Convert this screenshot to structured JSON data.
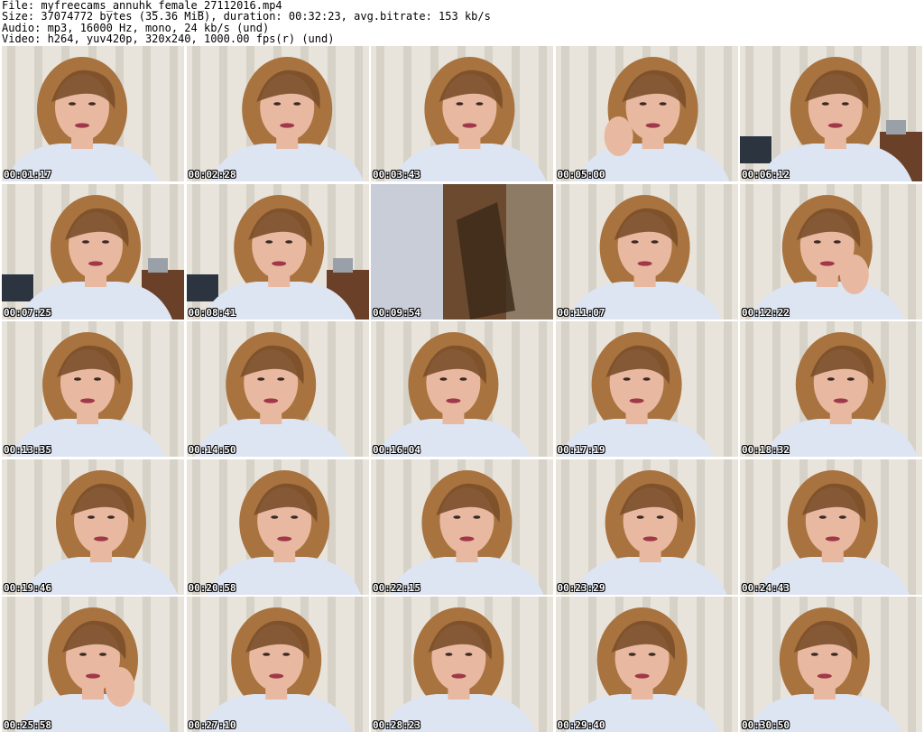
{
  "header": {
    "file": "File: myfreecams_annuhk_female_27112016.mp4",
    "size": "Size: 37074772 bytes (35.36 MiB), duration: 00:32:23, avg.bitrate: 153 kb/s",
    "audio": "Audio: mp3, 16000 Hz, mono, 24 kb/s (und)",
    "video": "Video: h264, yuv420p, 320x240, 1000.00 fps(r) (und)"
  },
  "thumbnails": [
    {
      "time": "00:01:17",
      "variant": "face"
    },
    {
      "time": "00:02:28",
      "variant": "face"
    },
    {
      "time": "00:03:43",
      "variant": "face"
    },
    {
      "time": "00:05:00",
      "variant": "pose"
    },
    {
      "time": "00:06:12",
      "variant": "room"
    },
    {
      "time": "00:07:25",
      "variant": "room"
    },
    {
      "time": "00:08:41",
      "variant": "room"
    },
    {
      "time": "00:09:54",
      "variant": "blur"
    },
    {
      "time": "00:11:07",
      "variant": "face"
    },
    {
      "time": "00:12:22",
      "variant": "hand"
    },
    {
      "time": "00:13:35",
      "variant": "face"
    },
    {
      "time": "00:14:50",
      "variant": "face"
    },
    {
      "time": "00:16:04",
      "variant": "face"
    },
    {
      "time": "00:17:19",
      "variant": "face"
    },
    {
      "time": "00:18:32",
      "variant": "face"
    },
    {
      "time": "00:19:46",
      "variant": "face"
    },
    {
      "time": "00:20:58",
      "variant": "face"
    },
    {
      "time": "00:22:15",
      "variant": "face"
    },
    {
      "time": "00:23:29",
      "variant": "face"
    },
    {
      "time": "00:24:43",
      "variant": "face"
    },
    {
      "time": "00:25:58",
      "variant": "hand"
    },
    {
      "time": "00:27:10",
      "variant": "face"
    },
    {
      "time": "00:28:23",
      "variant": "face"
    },
    {
      "time": "00:29:40",
      "variant": "face"
    },
    {
      "time": "00:30:50",
      "variant": "face"
    }
  ],
  "colors": {
    "wall_light": "#e8e4dc",
    "wall_stripe": "#c9c2b6",
    "hair": "#a8733f",
    "hair_dark": "#7a4f2a",
    "skin": "#e8b8a0",
    "shirt": "#dde4f2",
    "lips": "#a0384a"
  }
}
